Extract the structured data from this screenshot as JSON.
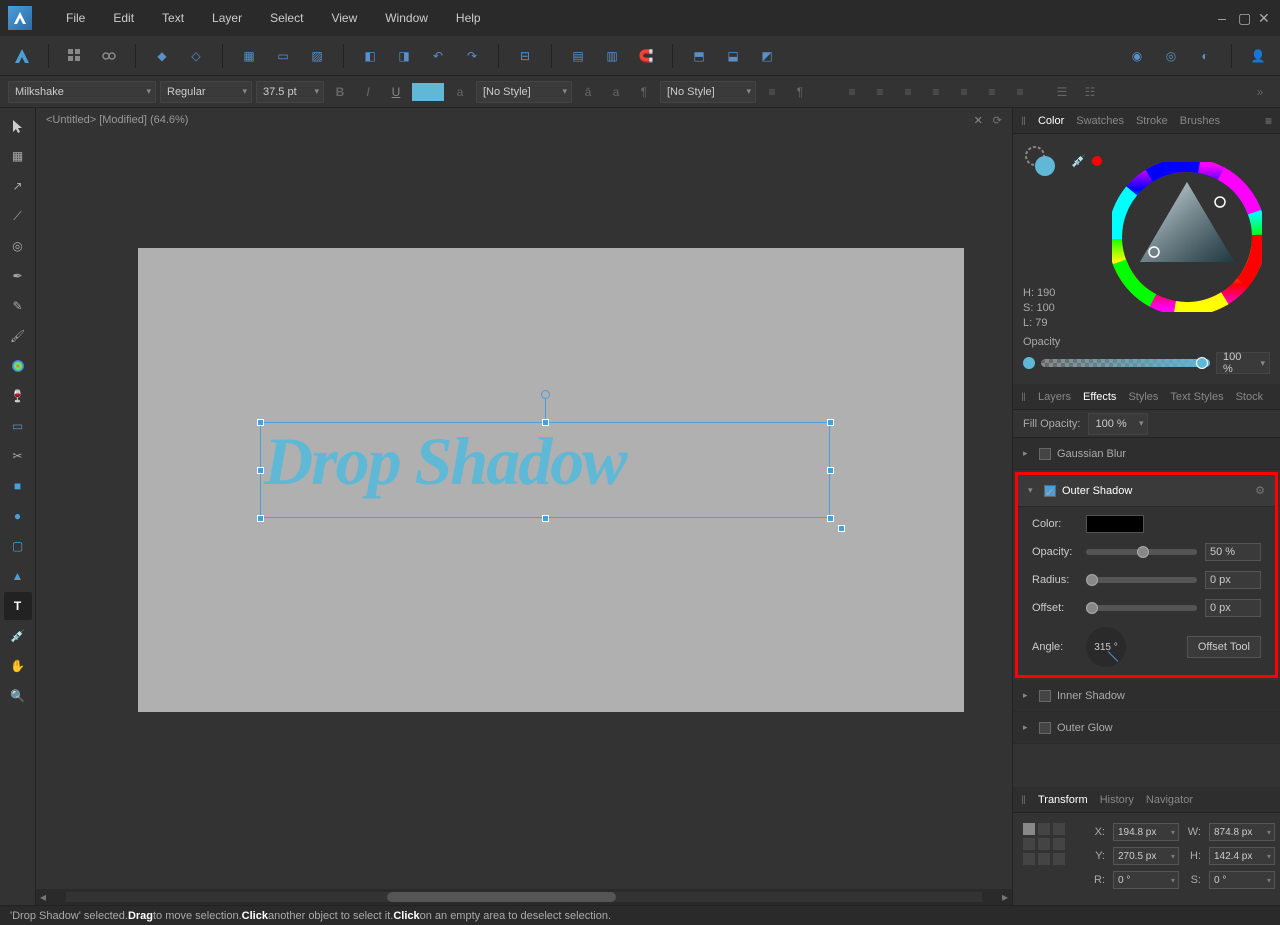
{
  "menu": {
    "items": [
      "File",
      "Edit",
      "Text",
      "Layer",
      "Select",
      "View",
      "Window",
      "Help"
    ]
  },
  "window": {
    "minimize": "–",
    "maximize": "▢",
    "close": "✕"
  },
  "text_toolbar": {
    "font": "Milkshake",
    "weight": "Regular",
    "size": "37.5 pt",
    "char_style": "[No Style]",
    "para_style": "[No Style]"
  },
  "document": {
    "tab_label": "<Untitled> [Modified] (64.6%)"
  },
  "canvas_text": "Drop Shadow",
  "color_panel": {
    "tabs": [
      "Color",
      "Swatches",
      "Stroke",
      "Brushes"
    ],
    "active_tab": "Color",
    "h_label": "H: 190",
    "s_label": "S: 100",
    "l_label": "L: 79",
    "opacity_label": "Opacity",
    "opacity_value": "100 %"
  },
  "layers_panel": {
    "tabs": [
      "Layers",
      "Effects",
      "Styles",
      "Text Styles",
      "Stock"
    ],
    "active_tab": "Effects",
    "fill_opacity_label": "Fill Opacity:",
    "fill_opacity_value": "100 %",
    "effects": {
      "gaussian_blur": "Gaussian Blur",
      "outer_shadow": "Outer Shadow",
      "inner_shadow": "Inner Shadow",
      "outer_glow": "Outer Glow"
    },
    "outer_shadow_props": {
      "color_label": "Color:",
      "color_value": "#000000",
      "opacity_label": "Opacity:",
      "opacity_value": "50 %",
      "radius_label": "Radius:",
      "radius_value": "0 px",
      "offset_label": "Offset:",
      "offset_value": "0 px",
      "angle_label": "Angle:",
      "angle_value": "315 °",
      "offset_tool_label": "Offset Tool"
    }
  },
  "bottom_panel": {
    "tabs": [
      "Transform",
      "History",
      "Navigator"
    ],
    "active_tab": "Transform",
    "x_label": "X:",
    "x_value": "194.8 px",
    "y_label": "Y:",
    "y_value": "270.5 px",
    "w_label": "W:",
    "w_value": "874.8 px",
    "h_label": "H:",
    "h_value": "142.4 px",
    "r_label": "R:",
    "r_value": "0 °",
    "s_label": "S:",
    "s_value": "0 °"
  },
  "statusbar": {
    "sel": "'Drop Shadow' selected. ",
    "drag_b": "Drag",
    "drag_t": " to move selection. ",
    "click_b": "Click",
    "click_t": " another object to select it. ",
    "click2_b": "Click",
    "click2_t": " on an empty area to deselect selection."
  }
}
